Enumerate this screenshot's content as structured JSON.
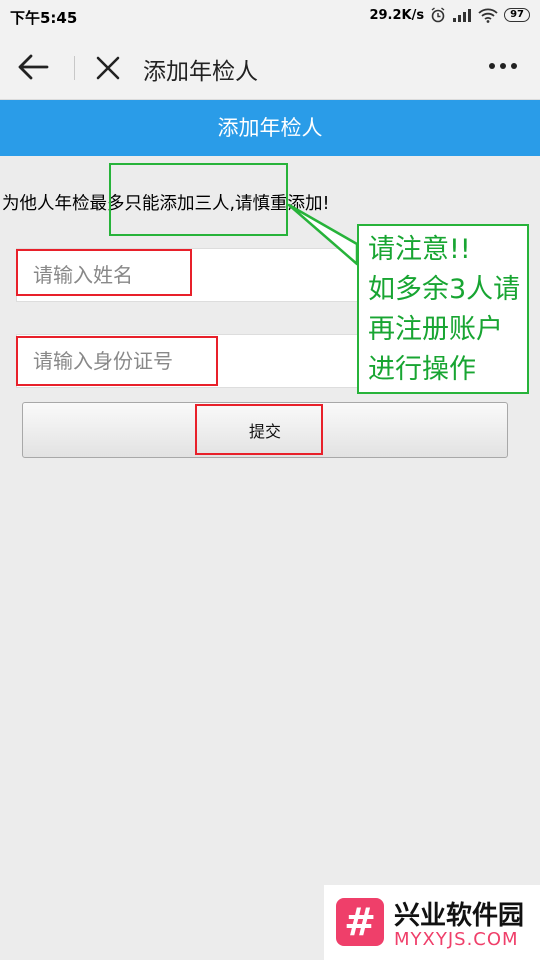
{
  "status_bar": {
    "time": "下午5:45",
    "speed": "29.2K/s",
    "battery": "97"
  },
  "nav": {
    "title": "添加年检人"
  },
  "header": {
    "title": "添加年检人"
  },
  "notice": "为他人年检最多只能添加三人,请慎重添加!",
  "form": {
    "name_placeholder": "请输入姓名",
    "id_placeholder": "请输入身份证号",
    "submit_label": "提交"
  },
  "callout": {
    "lines": [
      "请注意!!",
      "如多余3人请",
      "再注册账户",
      "进行操作"
    ]
  },
  "watermark": {
    "logo": "#",
    "name": "兴业软件园",
    "url": "MYXYJS.COM"
  },
  "colors": {
    "header_blue": "#2a9ce8",
    "annotation_red": "#e8202a",
    "annotation_green": "#27b33a"
  }
}
